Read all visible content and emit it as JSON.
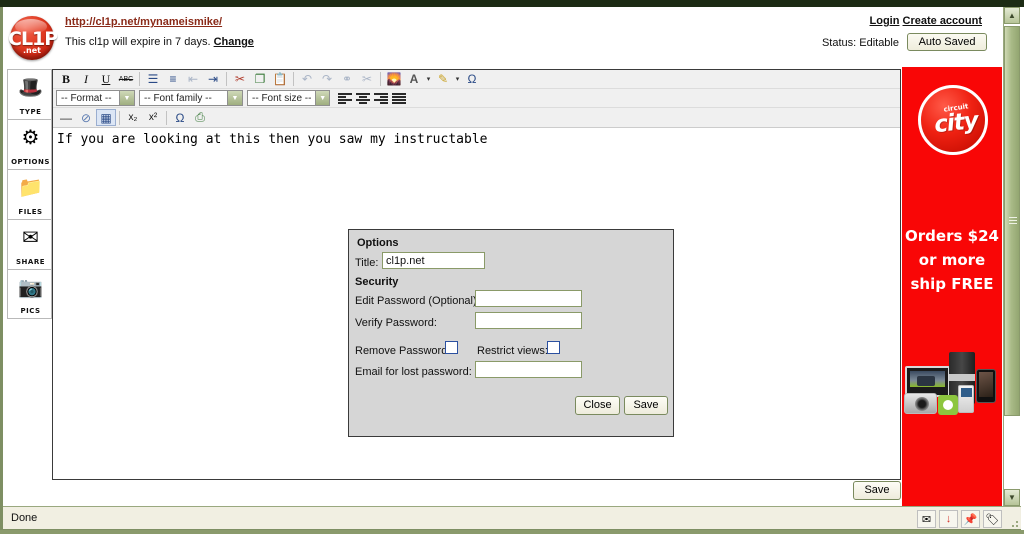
{
  "header": {
    "url": "http://cl1p.net/mynameismike/",
    "expire_prefix": "This cl1p will expire in 7 days.",
    "change_label": "Change",
    "login_label": "Login",
    "create_account_label": "Create account",
    "status_label": "Status: Editable",
    "autosaved_label": "Auto Saved"
  },
  "logo": {
    "word": "CL1P",
    "net": ".net"
  },
  "sidebar": {
    "items": [
      {
        "label": "TYPE",
        "icon": "magic-hat-icon",
        "glyph": "🎩"
      },
      {
        "label": "OPTIONS",
        "icon": "gears-icon",
        "glyph": "⚙"
      },
      {
        "label": "FILES",
        "icon": "folder-upload-icon",
        "glyph": "📁"
      },
      {
        "label": "SHARE",
        "icon": "envelope-star-icon",
        "glyph": "✉"
      },
      {
        "label": "PICS",
        "icon": "camera-icon",
        "glyph": "📷"
      }
    ]
  },
  "toolbar": {
    "row1": [
      {
        "name": "bold-icon",
        "glyph": "B",
        "state": "on"
      },
      {
        "name": "italic-icon",
        "glyph": "I",
        "state": "on"
      },
      {
        "name": "underline-icon",
        "glyph": "U",
        "state": "on"
      },
      {
        "name": "strikethrough-icon",
        "glyph": "ABC",
        "state": "on"
      },
      {
        "name": "bullet-list-icon",
        "glyph": "☰",
        "state": "on"
      },
      {
        "name": "numbered-list-icon",
        "glyph": "≡",
        "state": "on"
      },
      {
        "name": "outdent-icon",
        "glyph": "⇤",
        "state": "dim"
      },
      {
        "name": "indent-icon",
        "glyph": "⇥",
        "state": "on"
      },
      {
        "name": "cut-icon",
        "glyph": "✂",
        "state": "on"
      },
      {
        "name": "copy-icon",
        "glyph": "❐",
        "state": "on"
      },
      {
        "name": "paste-icon",
        "glyph": "📋",
        "state": "on"
      },
      {
        "name": "undo-icon",
        "glyph": "↶",
        "state": "dim"
      },
      {
        "name": "redo-icon",
        "glyph": "↷",
        "state": "dim"
      },
      {
        "name": "link-icon",
        "glyph": "⚭",
        "state": "dim"
      },
      {
        "name": "unlink-icon",
        "glyph": "✂",
        "state": "dim"
      },
      {
        "name": "image-icon",
        "glyph": "🌄",
        "state": "on"
      },
      {
        "name": "text-color-icon",
        "glyph": "A",
        "state": "on"
      },
      {
        "name": "text-color-dropdown-icon",
        "glyph": "▾",
        "state": "on"
      },
      {
        "name": "highlight-color-icon",
        "glyph": "✎",
        "state": "on"
      },
      {
        "name": "highlight-dropdown-icon",
        "glyph": "▾",
        "state": "on"
      },
      {
        "name": "special-char-icon",
        "glyph": "Ω",
        "state": "on"
      }
    ],
    "format_select": "-- Format --",
    "fontfamily_select": "-- Font family --",
    "fontsize_select": "-- Font size --",
    "align_buttons": [
      "align-left-icon",
      "align-center-icon",
      "align-right-icon",
      "align-justify-icon"
    ],
    "row3": [
      {
        "name": "horizontal-rule-icon",
        "glyph": "—",
        "state": "on"
      },
      {
        "name": "remove-format-icon",
        "glyph": "⊘",
        "state": "on"
      },
      {
        "name": "table-icon",
        "glyph": "▦",
        "state": "active"
      },
      {
        "name": "subscript-icon",
        "glyph": "x₂",
        "state": "on"
      },
      {
        "name": "superscript-icon",
        "glyph": "x²",
        "state": "on"
      },
      {
        "name": "omega-icon",
        "glyph": "Ω",
        "state": "on"
      },
      {
        "name": "print-icon",
        "glyph": "⎙",
        "state": "on"
      }
    ]
  },
  "document": {
    "text": "If you are looking at this then you saw my instructable"
  },
  "dialog": {
    "heading": "Options",
    "title_label": "Title:",
    "title_value": "cl1p.net",
    "security_heading": "Security",
    "edit_password_label": "Edit Password (Optional):",
    "edit_password_value": "",
    "verify_password_label": "Verify Password:",
    "verify_password_value": "",
    "remove_password_label": "Remove Password:",
    "restrict_views_label": "Restrict views:",
    "email_label": "Email for lost password:",
    "email_value": "",
    "close_label": "Close",
    "save_label": "Save"
  },
  "footer": {
    "save_label": "Save"
  },
  "ad": {
    "brand_small": "circuit",
    "brand_big": "city",
    "line1": "Orders $24",
    "line2": "or more",
    "line3": "ship FREE",
    "bg_color": "#f90606"
  },
  "statusbar": {
    "text": "Done",
    "tray": [
      {
        "name": "mail-icon",
        "glyph": "✉"
      },
      {
        "name": "download-icon",
        "glyph": "↓"
      },
      {
        "name": "pin-icon",
        "glyph": "📌"
      },
      {
        "name": "tag-icon",
        "glyph": "🏷"
      }
    ]
  },
  "scrollbar": {
    "up_glyph": "▲",
    "down_glyph": "▼"
  }
}
